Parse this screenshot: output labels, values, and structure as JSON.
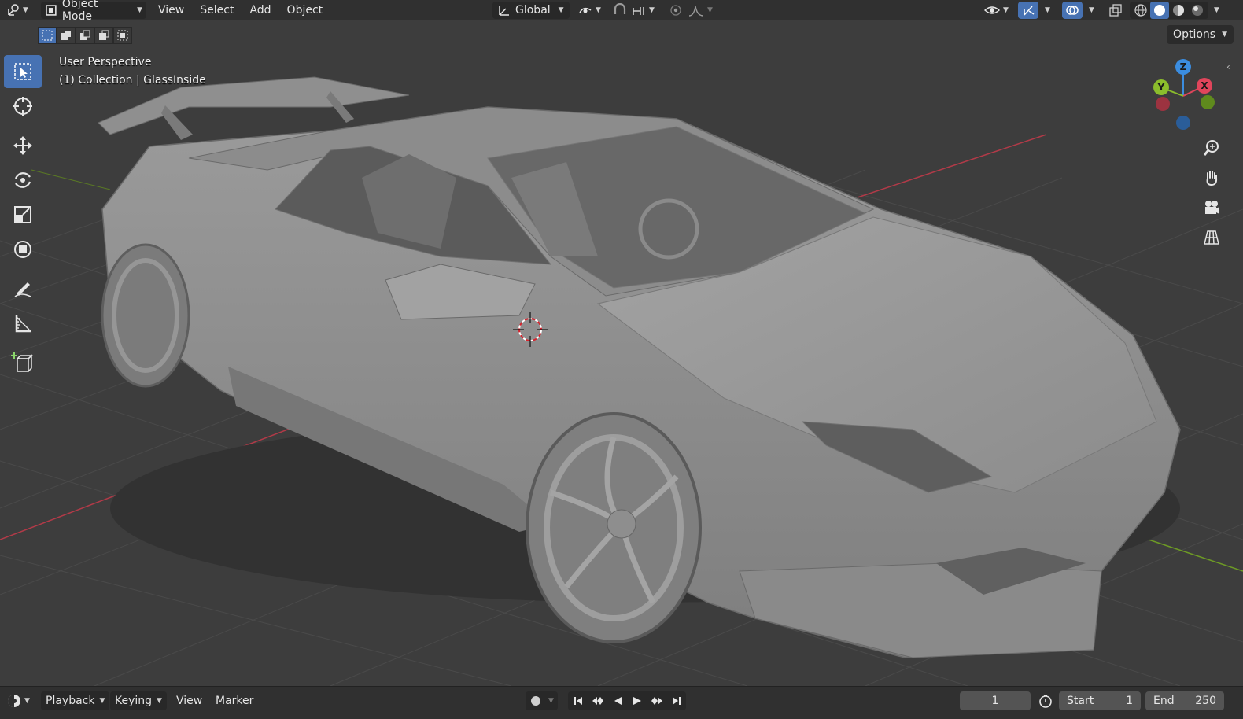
{
  "header": {
    "mode_label": "Object Mode",
    "menus": [
      "View",
      "Select",
      "Add",
      "Object"
    ],
    "orientation_label": "Global",
    "options_label": "Options"
  },
  "viewport": {
    "view_name": "User Perspective",
    "collection_info": "(1) Collection | GlassInside",
    "gizmo": {
      "z": "Z",
      "x": "X",
      "y": "Y"
    }
  },
  "timeline": {
    "menus": [
      "Playback",
      "Keying",
      "View",
      "Marker"
    ],
    "current_frame": "1",
    "start_label": "Start",
    "start_value": "1",
    "end_label": "End",
    "end_value": "250"
  },
  "colors": {
    "accent": "#4772b3",
    "axis_x": "#e0455b",
    "axis_y": "#8bbd2c",
    "axis_z": "#3b8de0",
    "viewport_bg": "#3d3d3d"
  },
  "icons": [
    "editor-type-icon",
    "object-mode-icon",
    "transform-orientation-icon",
    "pivot-icon",
    "snap-icon",
    "proportional-edit-icon",
    "visibility-icon",
    "gizmo-icon",
    "overlay-icon",
    "xray-icon",
    "shading-wireframe-icon",
    "shading-solid-icon",
    "shading-material-icon",
    "shading-rendered-icon",
    "select-box-icon",
    "cursor-icon",
    "move-icon",
    "rotate-icon",
    "scale-icon",
    "transform-icon",
    "annotate-icon",
    "measure-icon",
    "add-cube-icon",
    "zoom-icon",
    "pan-icon",
    "camera-icon",
    "perspective-icon",
    "record-icon",
    "jump-start-icon",
    "prev-keyframe-icon",
    "play-reverse-icon",
    "play-icon",
    "next-keyframe-icon",
    "jump-end-icon",
    "stopwatch-icon"
  ]
}
